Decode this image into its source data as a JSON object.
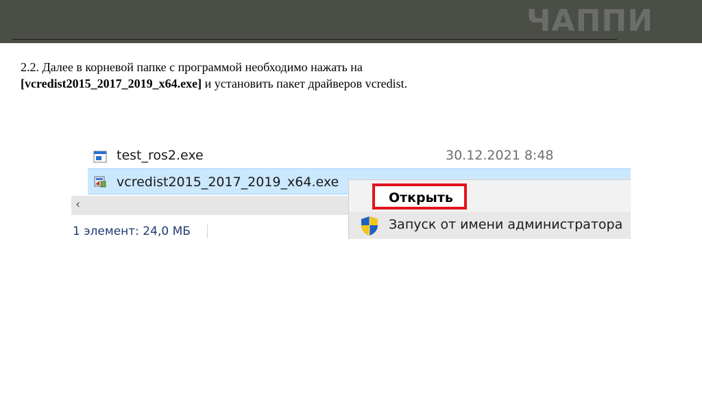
{
  "header": {
    "logo": "ЧАППИ"
  },
  "instruction": {
    "line1": "2.2.  Далее в корневой папке с программой необходимо нажать на",
    "bold": "[vcredist2015_2017_2019_x64.exe]",
    "line2_rest": " и установить пакет драйверов vcredist."
  },
  "explorer": {
    "rows": [
      {
        "name": "test_ros2.exe",
        "date": "30.12.2021 8:48",
        "icon": "app-window-icon"
      },
      {
        "name": "vcredist2015_2017_2019_x64.exe",
        "icon": "installer-icon",
        "selected": true
      }
    ],
    "scroll_left_glyph": "‹",
    "status": "1 элемент: 24,0 МБ"
  },
  "context_menu": {
    "items": [
      {
        "label": "Открыть",
        "highlighted": true
      },
      {
        "label": "Запуск от имени администратора",
        "icon": "uac-shield-icon"
      }
    ]
  },
  "colors": {
    "header": "#4b4d47",
    "selection": "#cce8ff",
    "highlight_border": "#e2141c"
  }
}
